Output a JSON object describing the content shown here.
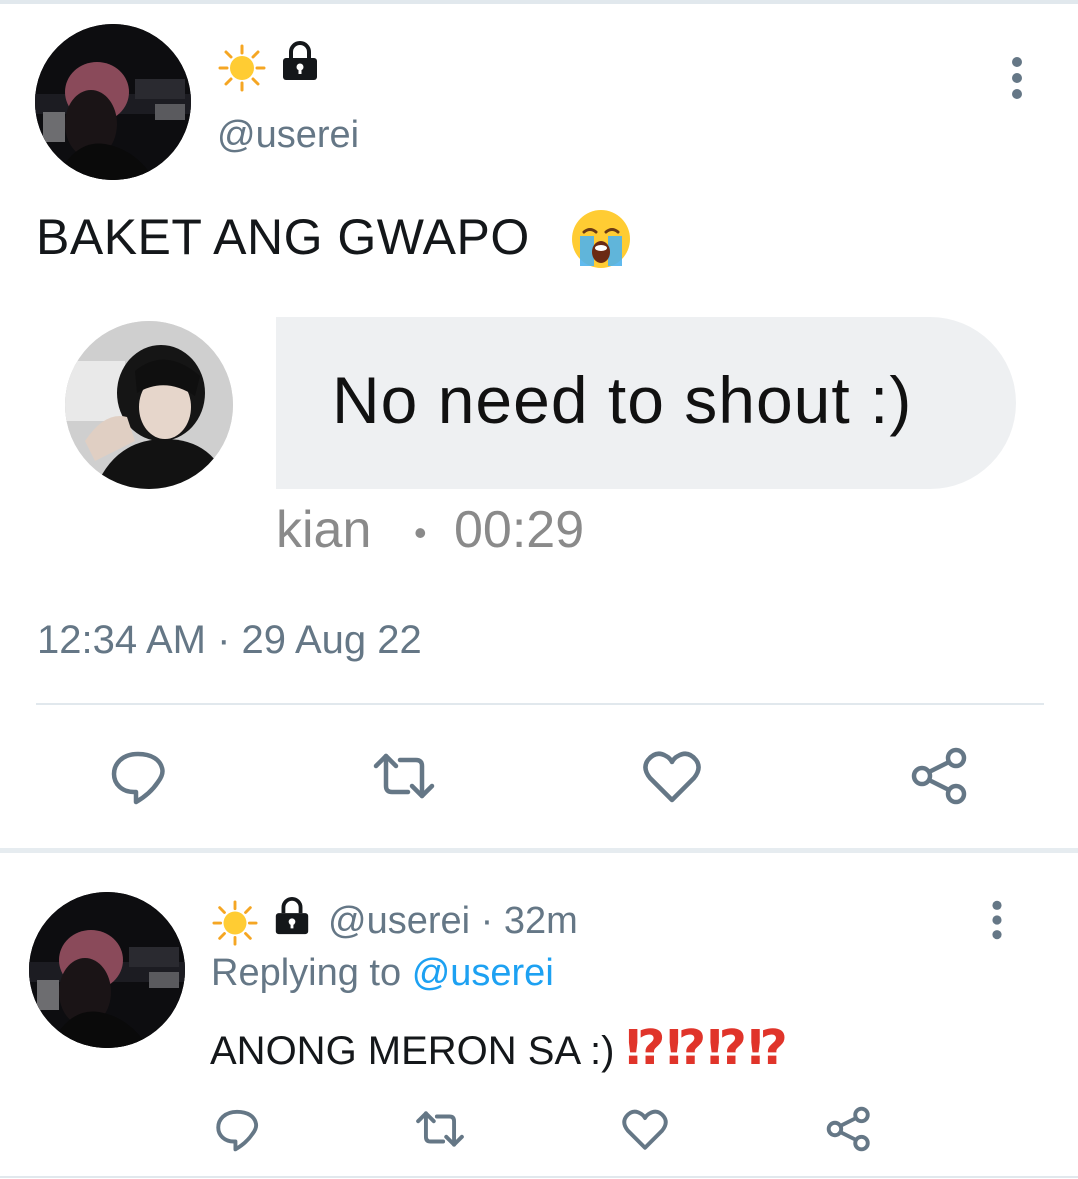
{
  "tweet": {
    "handle": "@userei",
    "text": "BAKET ANG GWAPO",
    "text_emoji": "loudly-crying-face",
    "name_icons": [
      "sun-icon",
      "lock-icon"
    ],
    "embedded_message": {
      "text": "No need to shout :)",
      "sender": "kian",
      "dot": "•",
      "time": "00:29"
    },
    "timestamp": "12:34 AM · 29 Aug 22",
    "actions": [
      "reply-icon",
      "retweet-icon",
      "like-icon",
      "share-icon"
    ]
  },
  "reply": {
    "handle": "@userei",
    "age": "· 32m",
    "replying_prefix": "Replying to",
    "replying_handle": "@userei",
    "text": "ANONG MERON SA :)",
    "interrobangs": "⁉⁉⁉⁉",
    "actions": [
      "reply-icon",
      "retweet-icon",
      "like-icon",
      "share-icon"
    ]
  },
  "colors": {
    "accent": "#1da1f2",
    "secondary_text": "#657786",
    "icon_gray": "#657786",
    "interrobang_red": "#e0342a",
    "bubble_bg": "#eef0f2"
  }
}
